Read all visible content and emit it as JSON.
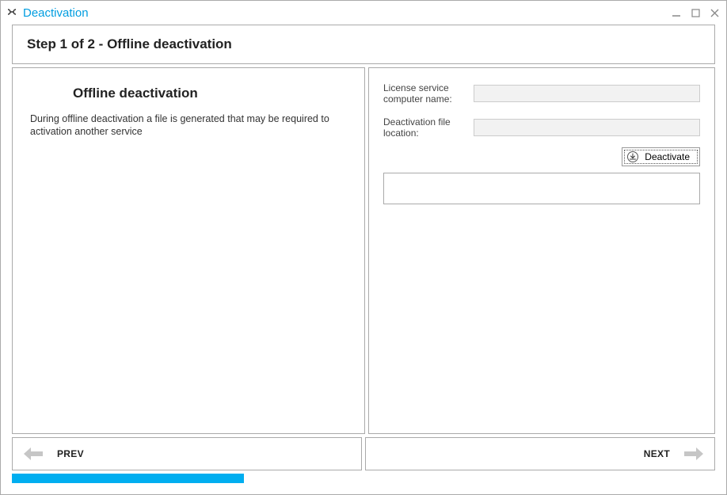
{
  "window": {
    "title": "Deactivation"
  },
  "step": {
    "header": "Step 1 of 2 - Offline deactivation"
  },
  "left": {
    "title": "Offline deactivation",
    "text": "During offline deactivation a file is generated that may be required to activation another service"
  },
  "form": {
    "license_label": "License service computer name:",
    "license_value": "",
    "location_label": "Deactivation file location:",
    "location_value": "",
    "deactivate_label": "Deactivate"
  },
  "nav": {
    "prev": "PREV",
    "next": "NEXT"
  },
  "progress": {
    "percent": 33
  }
}
